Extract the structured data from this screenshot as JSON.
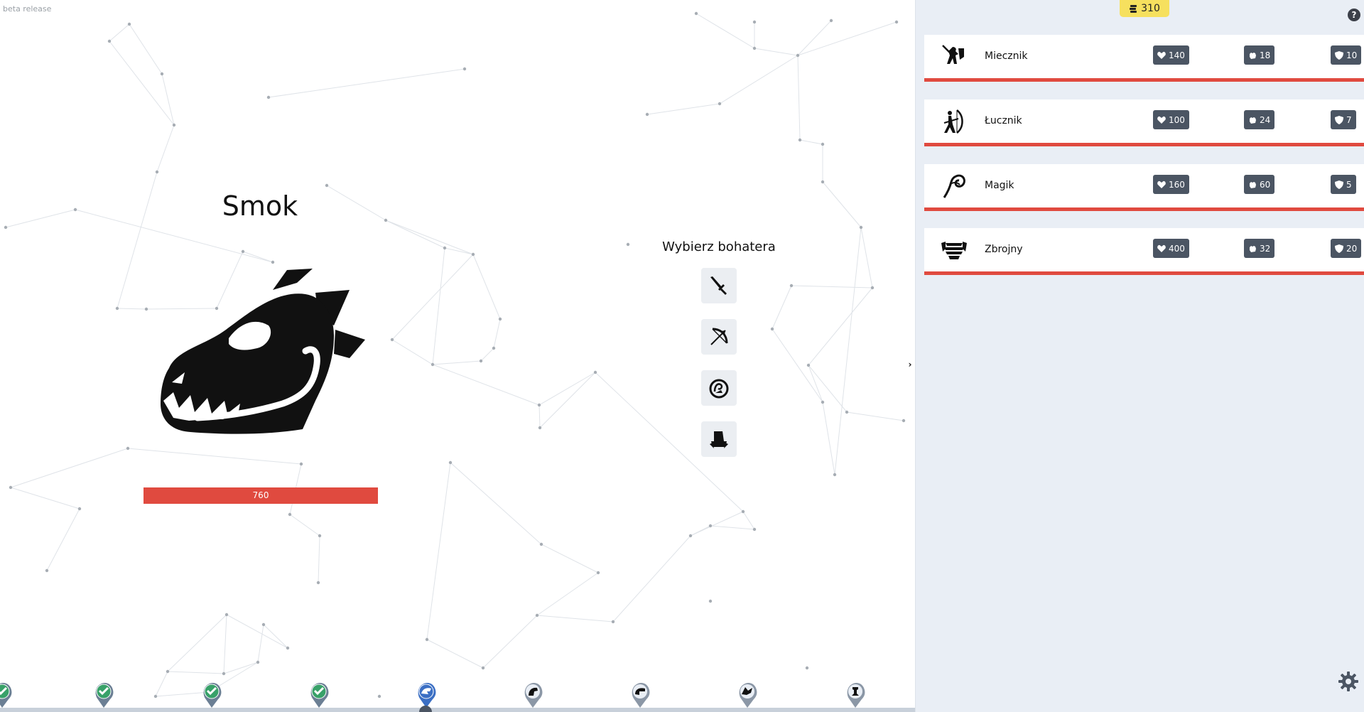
{
  "app": {
    "release_label": "beta release"
  },
  "enemy": {
    "name": "Smok",
    "hp": "760",
    "icon": "dragon-skull-icon"
  },
  "hero_select": {
    "title": "Wybierz bohatera",
    "buttons": [
      {
        "icon": "sword-icon"
      },
      {
        "icon": "bow-icon"
      },
      {
        "icon": "magic-swirl-icon"
      },
      {
        "icon": "armor-icon"
      }
    ]
  },
  "level_track": {
    "levels": [
      {
        "state": "completed",
        "icon": "check-icon"
      },
      {
        "state": "completed",
        "icon": "check-icon"
      },
      {
        "state": "completed",
        "icon": "check-icon"
      },
      {
        "state": "completed",
        "icon": "check-icon"
      },
      {
        "state": "current",
        "icon": "dragon-icon"
      },
      {
        "state": "locked",
        "icon": "horse-head-icon"
      },
      {
        "state": "locked",
        "icon": "helmet-icon"
      },
      {
        "state": "locked",
        "icon": "griffin-icon"
      },
      {
        "state": "locked",
        "icon": "chess-rook-icon"
      }
    ]
  },
  "panel": {
    "gold": "310",
    "help_label": "?",
    "heroes": [
      {
        "name": "Miecznik",
        "icon": "swordsman-icon",
        "hp": "140",
        "attack": "18",
        "defense": "10"
      },
      {
        "name": "Łucznik",
        "icon": "archer-icon",
        "hp": "100",
        "attack": "24",
        "defense": "7"
      },
      {
        "name": "Magik",
        "icon": "wizard-icon",
        "hp": "160",
        "attack": "60",
        "defense": "5"
      },
      {
        "name": "Zbrojny",
        "icon": "armored-icon",
        "hp": "400",
        "attack": "32",
        "defense": "20"
      }
    ]
  },
  "colors": {
    "health_bar": "#e04a3f",
    "stat_badge": "#4b5563",
    "gold_badge": "#f6e05e",
    "panel_bg": "#e9eef5",
    "completed_pin": "#6b7f94",
    "current_pin": "#3b6fc4",
    "check": "#38a169"
  }
}
